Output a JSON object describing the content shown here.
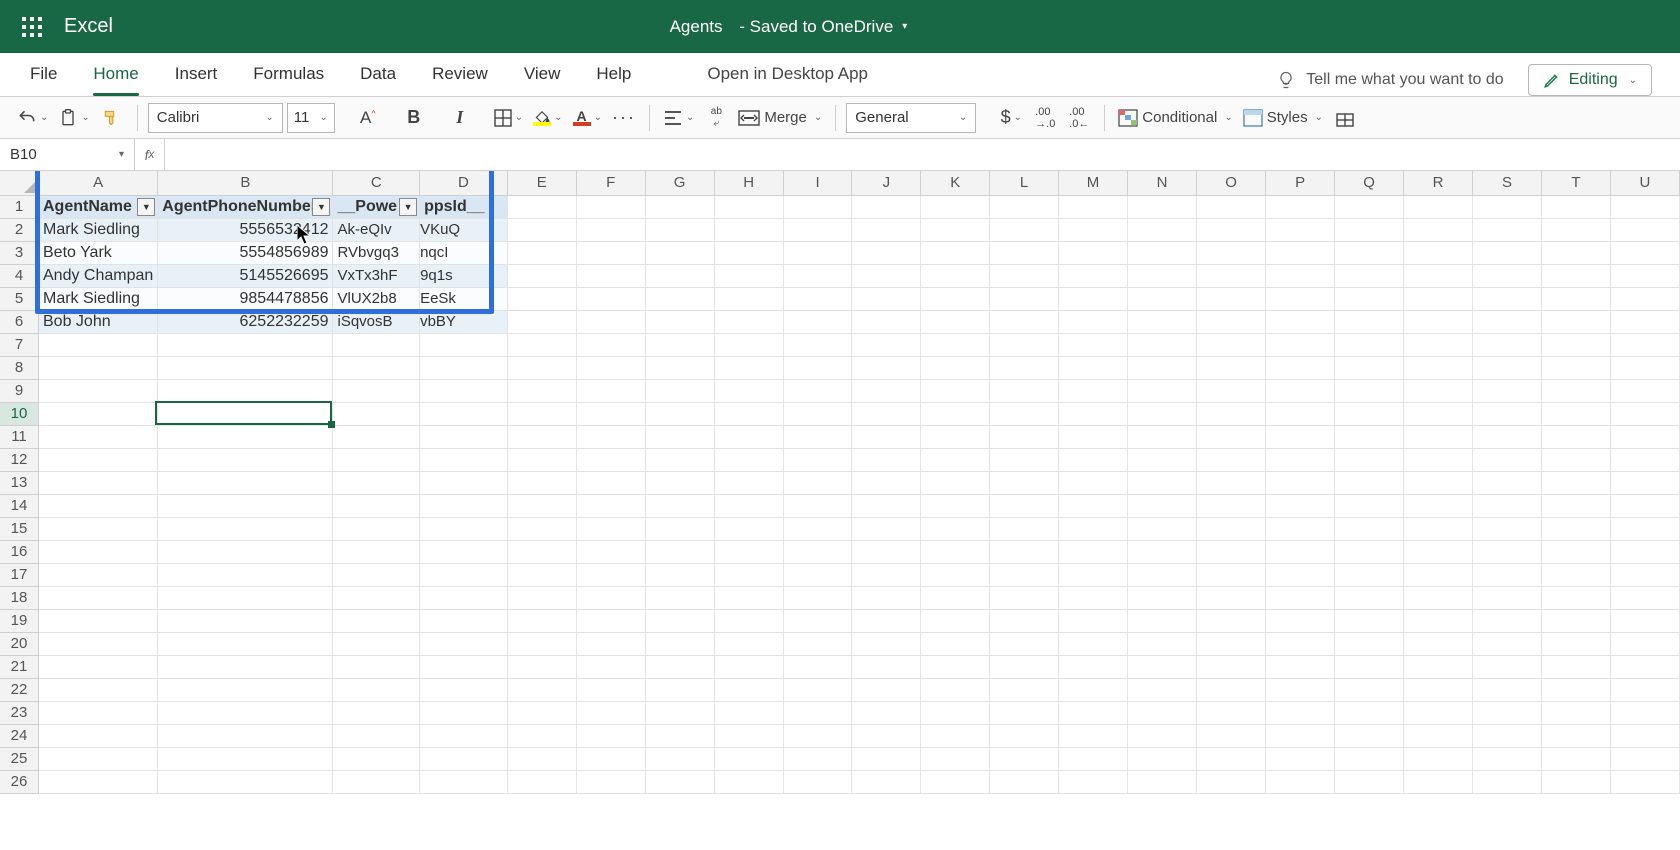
{
  "app": {
    "name": "Excel",
    "doc_title": "Agents",
    "doc_status": "- Saved to OneDrive"
  },
  "tabs": {
    "file": "File",
    "home": "Home",
    "insert": "Insert",
    "formulas": "Formulas",
    "data": "Data",
    "review": "Review",
    "view": "View",
    "help": "Help",
    "open_desktop": "Open in Desktop App"
  },
  "ribbon": {
    "tell_me": "Tell me what you want to do",
    "editing": "Editing"
  },
  "toolbar": {
    "font_name": "Calibri",
    "font_size": "11",
    "number_format": "General",
    "merge": "Merge",
    "conditional": "Conditional",
    "styles": "Styles"
  },
  "namebox": {
    "ref": "B10",
    "fx": ""
  },
  "columns": [
    "A",
    "B",
    "C",
    "D",
    "E",
    "F",
    "G",
    "H",
    "I",
    "J",
    "K",
    "L",
    "M",
    "N",
    "O",
    "P",
    "Q",
    "R",
    "S",
    "T",
    "U"
  ],
  "row_count": 26,
  "active_row": 10,
  "active_col_index": 1,
  "table": {
    "headers": [
      "AgentName",
      "AgentPhoneNumber",
      "__PowerAppsId__"
    ],
    "header_display_c": "__Powe",
    "header_display_d": "ppsId__",
    "rows": [
      {
        "name": "Mark Siedling",
        "phone": "5556532412",
        "id": "Ak-eQIvVKuQ"
      },
      {
        "name": "Beto Yark",
        "phone": "5554856989",
        "id": "RVbvgq3nqcI"
      },
      {
        "name": "Andy Champan",
        "phone": "5145526695",
        "id": "VxTx3hF9q1s"
      },
      {
        "name": "Mark Siedling",
        "phone": "9854478856",
        "id": "VlUX2b8EeSk"
      },
      {
        "name": "Bob John",
        "phone": "6252232259",
        "id": "iSqvosBvbBY"
      }
    ]
  }
}
